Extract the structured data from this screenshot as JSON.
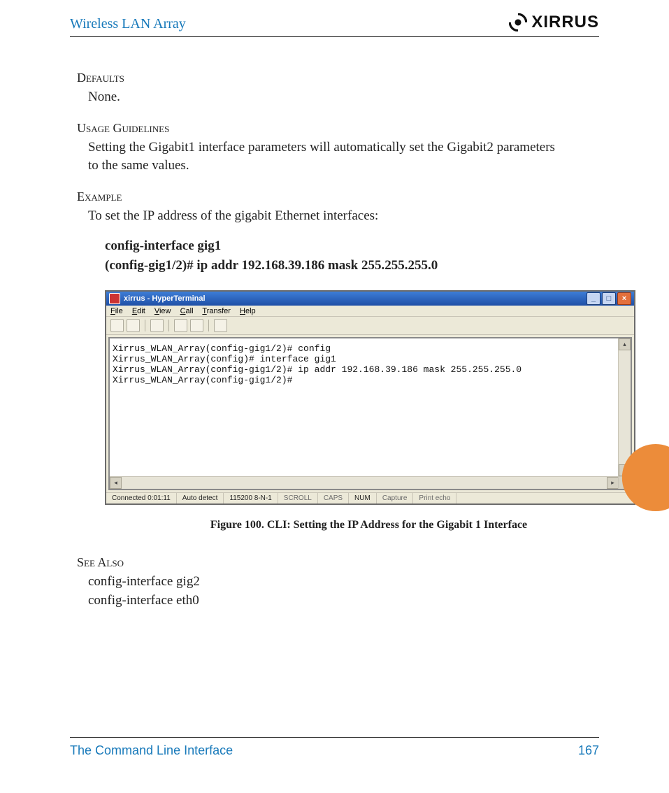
{
  "header": {
    "title": "Wireless LAN Array",
    "brand_text": "XIRRUS"
  },
  "sections": {
    "defaults_heading": "Defaults",
    "defaults_body": "None.",
    "usage_heading": "Usage Guidelines",
    "usage_body": "Setting the Gigabit1 interface parameters will automatically set the Gigabit2 parameters to the same values.",
    "example_heading": "Example",
    "example_body": "To set the IP address of the gigabit Ethernet interfaces:",
    "example_cmd1": "config-interface gig1",
    "example_cmd2": "(config-gig1/2)# ip addr 192.168.39.186 mask 255.255.255.0",
    "seealso_heading": "See Also",
    "seealso_item1": "config-interface gig2",
    "seealso_item2": "config-interface eth0"
  },
  "hyperterminal": {
    "window_title": "xirrus - HyperTerminal",
    "menu": {
      "file": "File",
      "edit": "Edit",
      "view": "View",
      "call": "Call",
      "transfer": "Transfer",
      "help": "Help"
    },
    "terminal_lines": [
      "Xirrus_WLAN_Array(config-gig1/2)# config",
      "Xirrus_WLAN_Array(config)# interface gig1",
      "Xirrus_WLAN_Array(config-gig1/2)# ip addr 192.168.39.186 mask 255.255.255.0",
      "Xirrus_WLAN_Array(config-gig1/2)#"
    ],
    "status": {
      "connected": "Connected 0:01:11",
      "detect": "Auto detect",
      "mode": "115200 8-N-1",
      "scroll": "SCROLL",
      "caps": "CAPS",
      "num": "NUM",
      "capture": "Capture",
      "print": "Print echo"
    }
  },
  "figure_caption": "Figure 100. CLI: Setting the IP Address for the Gigabit 1 Interface",
  "footer": {
    "left": "The Command Line Interface",
    "right": "167"
  }
}
